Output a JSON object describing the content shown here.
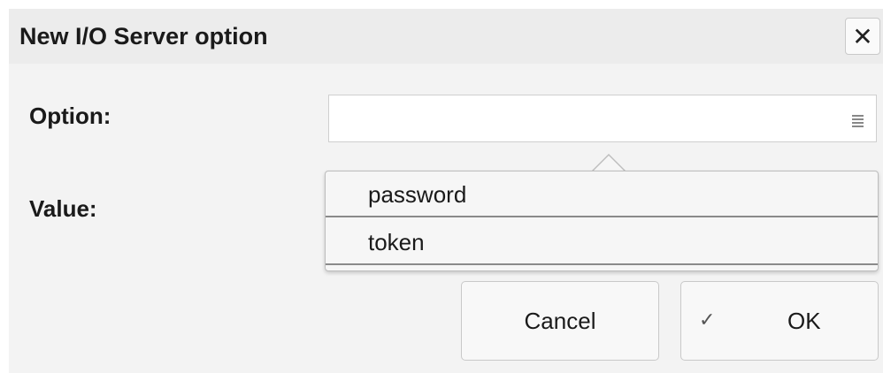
{
  "dialog": {
    "title": "New I/O Server option",
    "close_glyph": "✕"
  },
  "form": {
    "option_label": "Option:",
    "option_value": "",
    "value_label": "Value:"
  },
  "dropdown": {
    "items": [
      {
        "label": "password"
      },
      {
        "label": "token"
      }
    ]
  },
  "buttons": {
    "cancel_label": "Cancel",
    "ok_label": "OK",
    "ok_icon": "✓"
  },
  "icons": {
    "close": "close-icon",
    "list": "list-icon",
    "check": "checkmark-icon"
  }
}
